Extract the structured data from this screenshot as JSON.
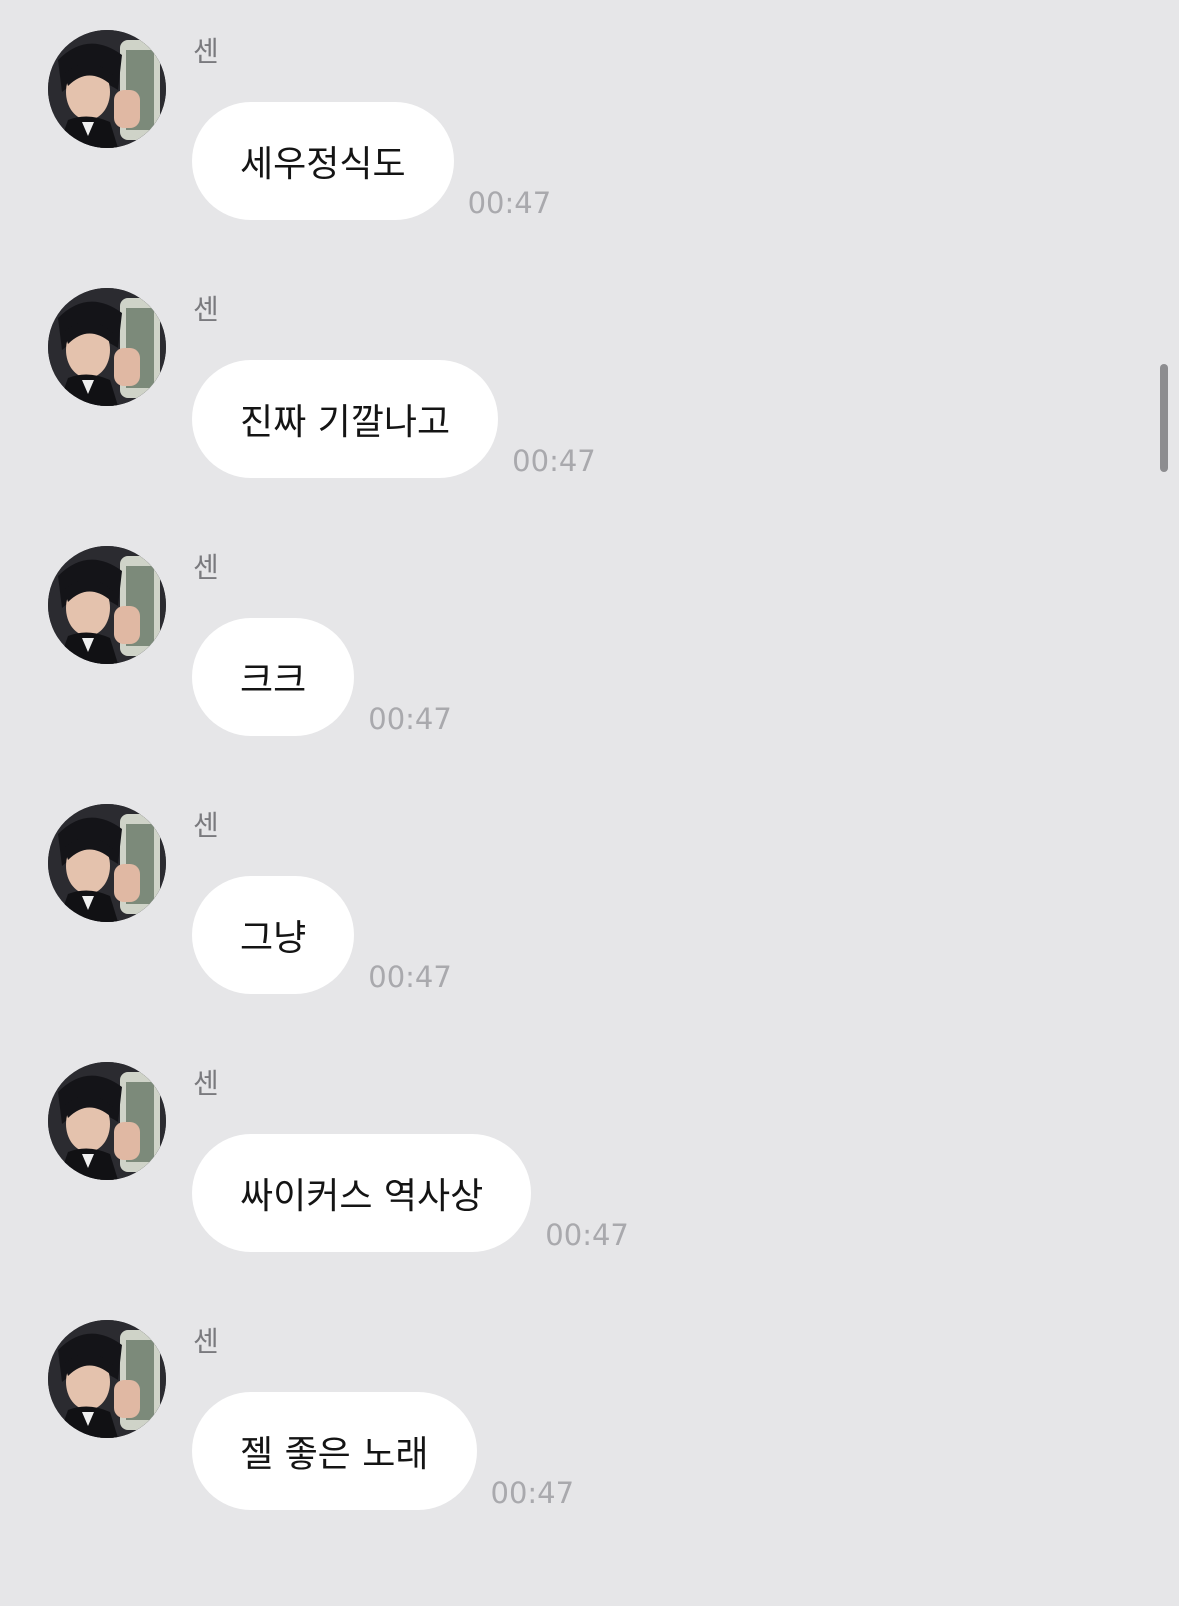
{
  "chat": {
    "messages": [
      {
        "sender": "센",
        "text": "세우정식도",
        "time": "00:47"
      },
      {
        "sender": "센",
        "text": "진짜 기깔나고",
        "time": "00:47"
      },
      {
        "sender": "센",
        "text": "크크",
        "time": "00:47"
      },
      {
        "sender": "센",
        "text": "그냥",
        "time": "00:47"
      },
      {
        "sender": "센",
        "text": "싸이커스 역사상",
        "time": "00:47"
      },
      {
        "sender": "센",
        "text": "젤 좋은 노래",
        "time": "00:47"
      }
    ]
  },
  "colors": {
    "background": "#e6e6e8",
    "bubble": "#ffffff",
    "text": "#141414",
    "timestamp": "#a9a9ad",
    "sender": "#7a7a7e"
  },
  "icons": {
    "avatar": "profile-photo",
    "scrollbar": "vertical-scroll-thumb"
  }
}
